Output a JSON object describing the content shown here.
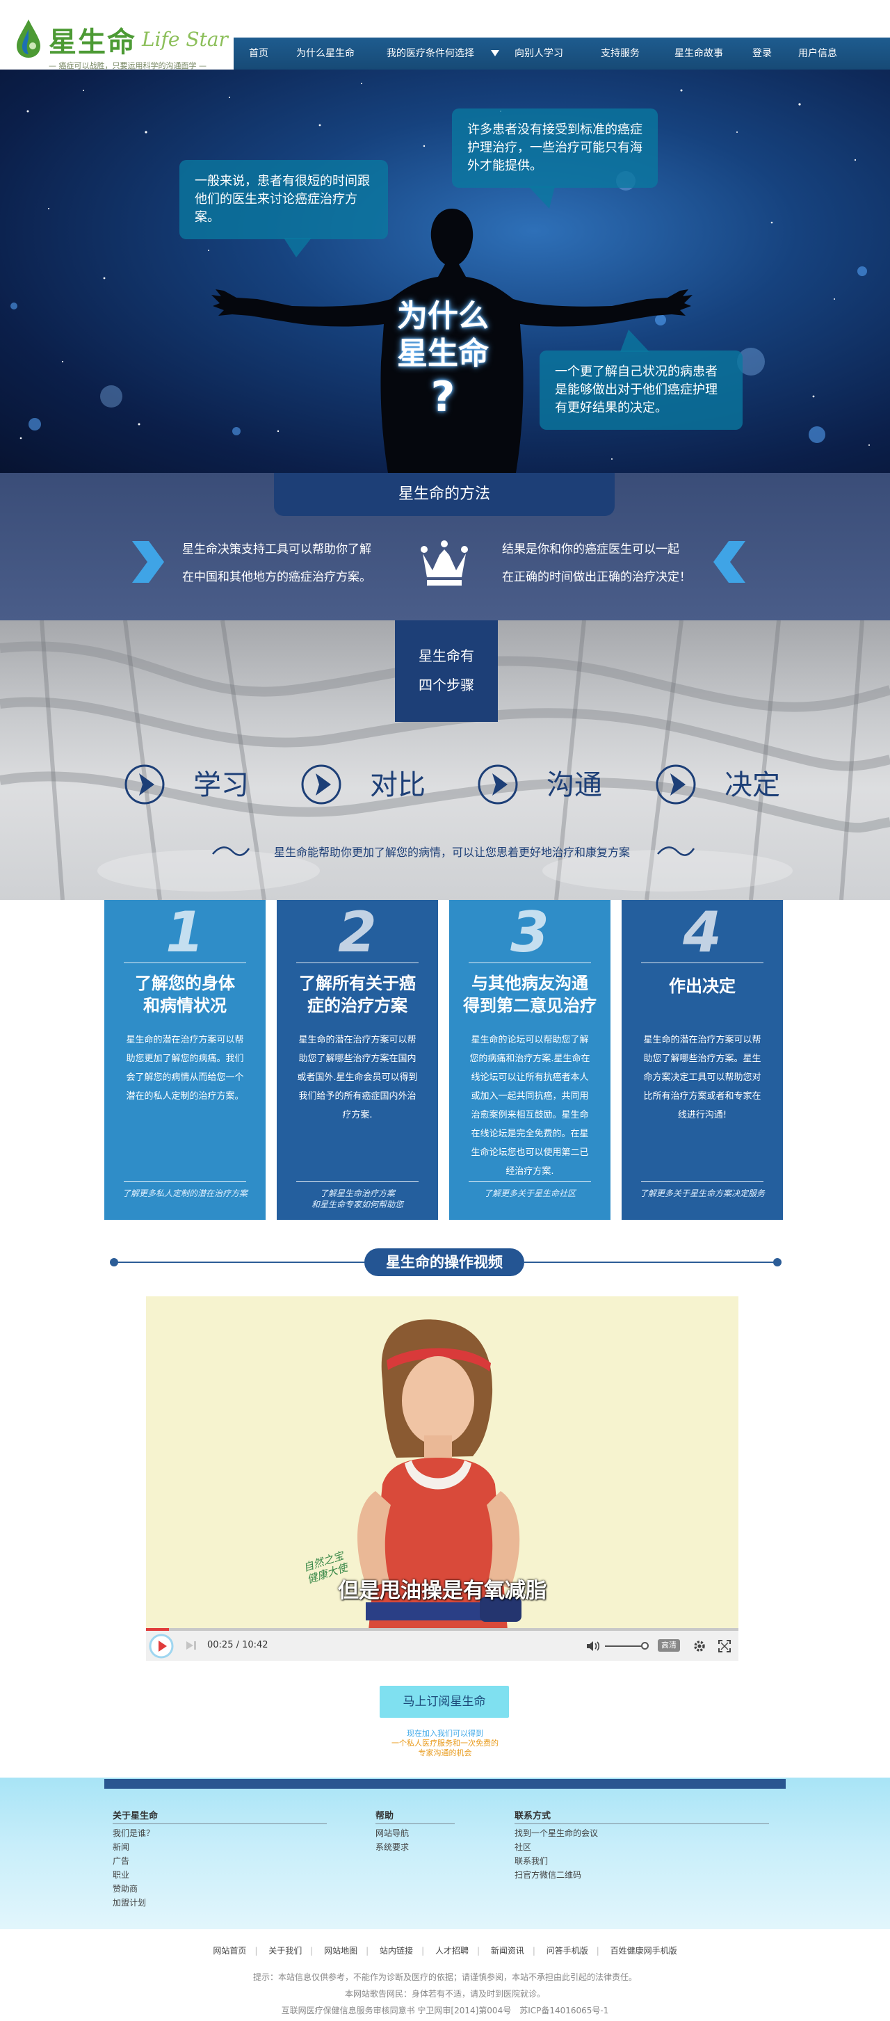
{
  "header": {
    "logo_cn": "星生命",
    "logo_en": "Life Star",
    "slogan": "— 癌症可以战胜，只要运用科学的沟通面学 —",
    "nav": [
      "首页",
      "为什么星生命",
      "我的医疗条件何选择",
      "向别人学习",
      "支持服务",
      "星生命故事",
      "登录",
      "用户信息"
    ]
  },
  "hero": {
    "bubble_left": "一般来说，患者有很短的时间跟他们的医生来讨论癌症治疗方案。",
    "bubble_top": "许多患者没有接受到标准的癌症护理治疗，一些治疗可能只有海外才能提供。",
    "bubble_right": "一个更了解自己状况的病患者是能够做出对于他们癌症护理有更好结果的决定。",
    "question_line1": "为什么",
    "question_line2": "星生命",
    "question_mark": "?"
  },
  "method": {
    "title": "星生命的方法",
    "left_line1": "星生命决策支持工具可以帮助你了解",
    "left_line2": "在中国和其他地方的癌症治疗方案。",
    "right_line1": "结果是你和你的癌症医生可以一起",
    "right_line2": "在正确的时间做出正确的治疗决定！"
  },
  "steps": {
    "box_line1": "星生命有",
    "box_line2": "四个步骤",
    "items": [
      "学习",
      "对比",
      "沟通",
      "决定"
    ],
    "note": "星生命能帮助你更加了解您的病情，可以让您思着更好地治疗和康复方案"
  },
  "cards": [
    {
      "num": "1",
      "title_line1": "了解您的身体",
      "title_line2": "和病情状况",
      "body": "星生命的潜在治疗方案可以帮助您更加了解您的病痛。我们会了解您的病情从而给您一个潜在的私人定制的治疗方案。",
      "link_line1": "了解更多私人定制的潜在治疗方案",
      "link_line2": "",
      "color": "#2f8dc8"
    },
    {
      "num": "2",
      "title_line1": "了解所有关于癌",
      "title_line2": "症的治疗方案",
      "body": "星生命的潜在治疗方案可以帮助您了解哪些治疗方案在国内或者国外.星生命会员可以得到我们给予的所有癌症国内外治疗方案.",
      "link_line1": "了解星生命治疗方案",
      "link_line2": "和星生命专家如何帮助您",
      "color": "#245f9e"
    },
    {
      "num": "3",
      "title_line1": "与其他病友沟通",
      "title_line2": "得到第二意见治疗",
      "body": "星生命的论坛可以帮助您了解您的病痛和治疗方案.星生命在线论坛可以让所有抗癌者本人或加入一起共同抗癌，共同用治愈案例来相互鼓励。星生命在线论坛是完全免费的。在星生命论坛您也可以使用第二已经治疗方案.",
      "link_line1": "了解更多关于星生命社区",
      "link_line2": "",
      "color": "#2f8dc8"
    },
    {
      "num": "4",
      "title_line1": "作出决定",
      "title_line2": "",
      "body": "星生命的潜在治疗方案可以帮助您了解哪些治疗方案。星生命方案决定工具可以帮助您对比所有治疗方案或者和专家在线进行沟通!",
      "link_line1": "了解更多关于星生命方案决定服务",
      "link_line2": "",
      "color": "#245f9e"
    }
  ],
  "video": {
    "heading": "星生命的操作视频",
    "subtitle": "但是甩油操是有氧减脂",
    "watermark_line1": "自然之宝",
    "watermark_line2": "健康大使",
    "time": "00:25 / 10:42",
    "hd_label": "高清",
    "progress": 0.039
  },
  "subscribe": {
    "button": "马上订阅星生命",
    "line1": "现在加入我们可以得到",
    "line2": "一个私人医疗服务和一次免费的",
    "line3": "专家沟通的机会"
  },
  "footer": {
    "columns": [
      {
        "title": "关于星生命",
        "links": [
          "我们是谁？",
          "新闻",
          "广告",
          "职业",
          "赞助商",
          "加盟计划"
        ]
      },
      {
        "title": "帮助",
        "links": [
          "网站导航",
          "系统要求"
        ]
      },
      {
        "title": "联系方式",
        "links": [
          "找到一个星生命的会议",
          "社区",
          "联系我们",
          "扫官方微信二维码"
        ]
      }
    ],
    "bottom_links": [
      "网站首页",
      "关于我们",
      "网站地图",
      "站内链接",
      "人才招聘",
      "新闻资讯",
      "问答手机版",
      "百姓健康网手机版"
    ],
    "legal_line1": "提示：本站信息仅供参考，不能作为诊断及医疗的依据；请谨慎参阅，本站不承担由此引起的法律责任。",
    "legal_line2": "本网站歌告网民：身体若有不适，请及时到医院就诊。",
    "legal_line3": "互联网医疗保健信息服务审核同意书 宁卫网审[2014]第004号　苏ICP备14016065号-1"
  },
  "colors": {
    "nav": "#1e5c8f",
    "brand_blue": "#1d3f77",
    "card_light": "#2f8dc8",
    "card_dark": "#245f9e",
    "subscribe": "#7fe0f0",
    "promo_blue": "#3ea8e8",
    "promo_orange": "#e89a1a"
  }
}
